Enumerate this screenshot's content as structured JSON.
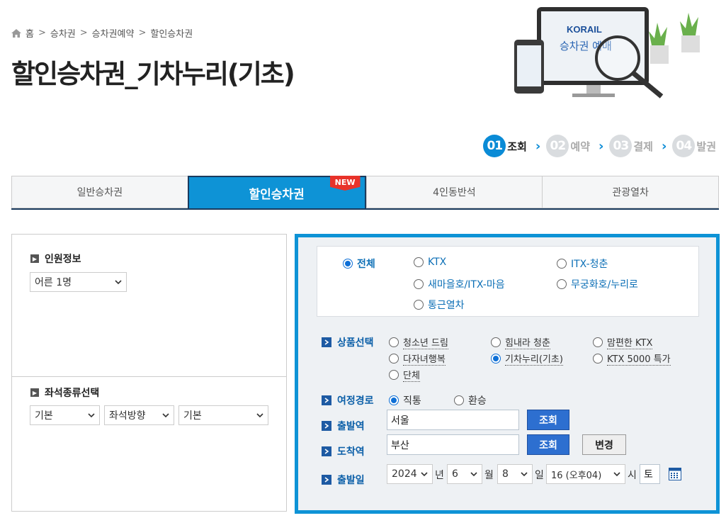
{
  "breadcrumb": {
    "home": "홈",
    "items": [
      "승차권",
      "승차권예약",
      "할인승차권"
    ]
  },
  "page_title": "할인승차권_기차누리(기초)",
  "hero": {
    "brand": "KORAIL",
    "caption": "승차권 예매"
  },
  "steps": [
    {
      "num": "01",
      "label": "조회"
    },
    {
      "num": "02",
      "label": "예약"
    },
    {
      "num": "03",
      "label": "결제"
    },
    {
      "num": "04",
      "label": "발권"
    }
  ],
  "tabs": [
    {
      "label": "일반승차권"
    },
    {
      "label": "할인승차권",
      "badge": "NEW"
    },
    {
      "label": "4인동반석"
    },
    {
      "label": "관광열차"
    }
  ],
  "left": {
    "passenger_title": "인원정보",
    "passenger_select": "어른 1명",
    "seat_title": "좌석종류선택",
    "seat_selects": [
      "기본",
      "좌석방향",
      "기본"
    ]
  },
  "train_types": {
    "all": "전체",
    "ktx": "KTX",
    "itx_youth": "ITX-청춘",
    "saemaeul": "새마을호/ITX-마음",
    "mugunghwa": "무궁화호/누리로",
    "commuter": "통근열차"
  },
  "products": {
    "label": "상품선택",
    "items": [
      "청소년 드림",
      "힘내라 청춘",
      "맘편한 KTX",
      "다자녀행복",
      "기차누리(기초)",
      "KTX 5000 특가",
      "단체"
    ]
  },
  "route": {
    "label": "여정경로",
    "direct": "직통",
    "transfer": "환승"
  },
  "departure": {
    "label": "출발역",
    "value": "서울",
    "btn": "조회"
  },
  "arrival": {
    "label": "도착역",
    "value": "부산",
    "btn": "조회",
    "change_btn": "변경"
  },
  "date": {
    "label": "출발일",
    "year": "2024",
    "year_unit": "년",
    "month": "6",
    "month_unit": "월",
    "day": "8",
    "day_unit": "일",
    "hour": "16 (오후04)",
    "hour_unit": "시",
    "weekday": "토"
  }
}
